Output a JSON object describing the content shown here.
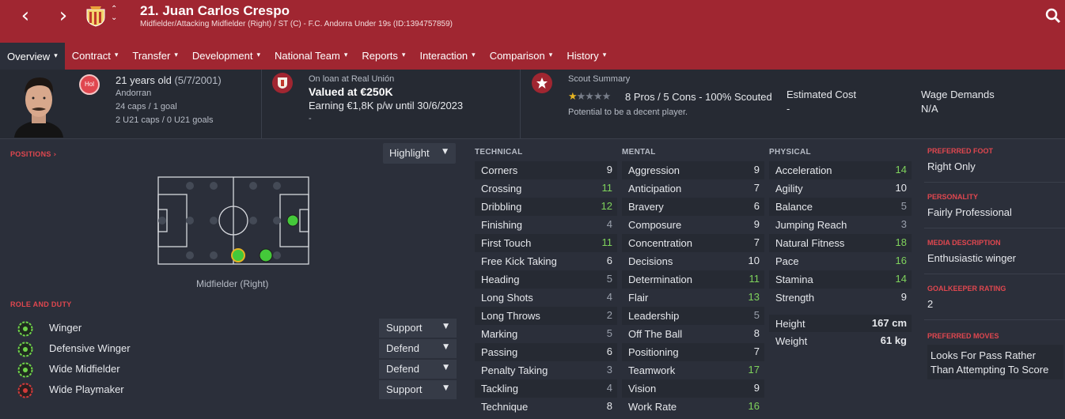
{
  "header": {
    "player_name": "21. Juan Carlos Crespo",
    "subtitle": "Midfielder/Attacking Midfielder (Right) / ST (C) - F.C. Andorra Under 19s (ID:1394757859)",
    "back_icon": "chevron-left-icon",
    "forward_icon": "chevron-right-icon",
    "search_icon": "search-icon",
    "tabs": [
      {
        "label": "Overview"
      },
      {
        "label": "Contract"
      },
      {
        "label": "Transfer"
      },
      {
        "label": "Development"
      },
      {
        "label": "National Team"
      },
      {
        "label": "Reports"
      },
      {
        "label": "Interaction"
      },
      {
        "label": "Comparison"
      },
      {
        "label": "History"
      }
    ]
  },
  "info": {
    "badge": "Hol",
    "age": "21 years old",
    "dob": "(5/7/2001)",
    "nationality": "Andorran",
    "caps": "24 caps / 1 goal",
    "u21_caps": "2 U21 caps / 0 U21 goals",
    "loan_status": "On loan at Real Unión",
    "value": "Valued at €250K",
    "earning": "Earning €1,8K p/w until 30/6/2023",
    "loan_extra": "-",
    "scout_title": "Scout Summary",
    "scout_line": "8 Pros / 5 Cons - 100% Scouted",
    "scout_rating_stars": 1,
    "potential": "Potential to be a decent player.",
    "estimated_cost_label": "Estimated Cost",
    "estimated_cost": "-",
    "wage_label": "Wage Demands",
    "wage": "N/A"
  },
  "positions": {
    "title": "POSITIONS",
    "highlight": "Highlight",
    "position_label": "Midfielder (Right)",
    "role_title": "ROLE AND DUTY",
    "roles": [
      {
        "name": "Winger",
        "duty": "Support"
      },
      {
        "name": "Defensive Winger",
        "duty": "Defend"
      },
      {
        "name": "Wide Midfielder",
        "duty": "Defend"
      },
      {
        "name": "Wide Playmaker",
        "duty": "Support"
      }
    ]
  },
  "technical": {
    "title": "TECHNICAL",
    "items": [
      {
        "name": "Corners",
        "value": "9"
      },
      {
        "name": "Crossing",
        "value": "11"
      },
      {
        "name": "Dribbling",
        "value": "12"
      },
      {
        "name": "Finishing",
        "value": "4"
      },
      {
        "name": "First Touch",
        "value": "11"
      },
      {
        "name": "Free Kick Taking",
        "value": "6"
      },
      {
        "name": "Heading",
        "value": "5"
      },
      {
        "name": "Long Shots",
        "value": "4"
      },
      {
        "name": "Long Throws",
        "value": "2"
      },
      {
        "name": "Marking",
        "value": "5"
      },
      {
        "name": "Passing",
        "value": "6"
      },
      {
        "name": "Penalty Taking",
        "value": "3"
      },
      {
        "name": "Tackling",
        "value": "4"
      },
      {
        "name": "Technique",
        "value": "8"
      }
    ]
  },
  "mental": {
    "title": "MENTAL",
    "items": [
      {
        "name": "Aggression",
        "value": "9"
      },
      {
        "name": "Anticipation",
        "value": "7"
      },
      {
        "name": "Bravery",
        "value": "6"
      },
      {
        "name": "Composure",
        "value": "9"
      },
      {
        "name": "Concentration",
        "value": "7"
      },
      {
        "name": "Decisions",
        "value": "10"
      },
      {
        "name": "Determination",
        "value": "11"
      },
      {
        "name": "Flair",
        "value": "13"
      },
      {
        "name": "Leadership",
        "value": "5"
      },
      {
        "name": "Off The Ball",
        "value": "8"
      },
      {
        "name": "Positioning",
        "value": "7"
      },
      {
        "name": "Teamwork",
        "value": "17"
      },
      {
        "name": "Vision",
        "value": "9"
      },
      {
        "name": "Work Rate",
        "value": "16"
      }
    ]
  },
  "physical": {
    "title": "PHYSICAL",
    "items": [
      {
        "name": "Acceleration",
        "value": "14"
      },
      {
        "name": "Agility",
        "value": "10"
      },
      {
        "name": "Balance",
        "value": "5"
      },
      {
        "name": "Jumping Reach",
        "value": "3"
      },
      {
        "name": "Natural Fitness",
        "value": "18"
      },
      {
        "name": "Pace",
        "value": "16"
      },
      {
        "name": "Stamina",
        "value": "14"
      },
      {
        "name": "Strength",
        "value": "9"
      }
    ],
    "height_label": "Height",
    "height": "167 cm",
    "weight_label": "Weight",
    "weight": "61 kg"
  },
  "details": {
    "preferred_foot_label": "PREFERRED FOOT",
    "preferred_foot": "Right Only",
    "personality_label": "PERSONALITY",
    "personality": "Fairly Professional",
    "media_label": "MEDIA DESCRIPTION",
    "media": "Enthusiastic winger",
    "gk_label": "GOALKEEPER RATING",
    "gk": "2",
    "moves_label": "PREFERRED MOVES",
    "moves": "Looks For Pass Rather Than Attempting To Score"
  },
  "colors": {
    "brand_red": "#a02631",
    "high_attr": "#7fd35c",
    "bg": "#2b2f3a"
  }
}
